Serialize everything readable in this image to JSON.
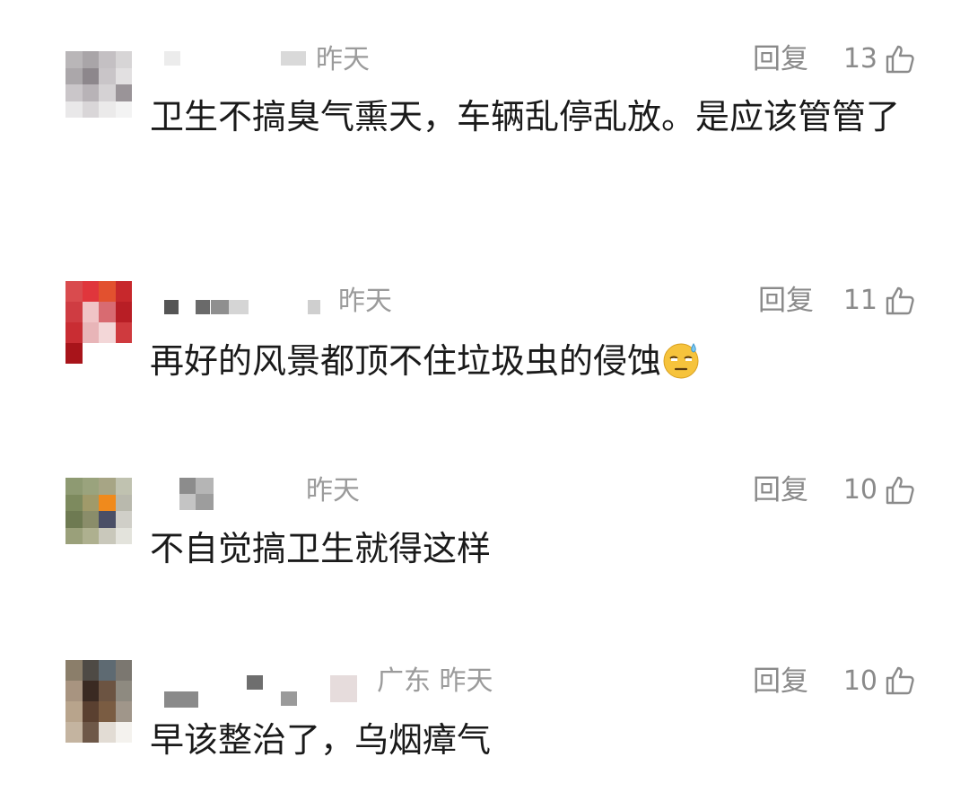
{
  "comments": [
    {
      "location_time": "昨天",
      "reply_label": "回复",
      "likes": "13",
      "text": "卫生不搞臭气熏天，车辆乱停乱放。是应该管管了",
      "thumb_icon": "thumb-up-icon"
    },
    {
      "location_time": "昨天",
      "reply_label": "回复",
      "likes": "11",
      "text": "再好的风景都顶不住垃圾虫的侵蚀",
      "emoji": "sweat-smile-emoji-icon",
      "thumb_icon": "thumb-up-icon"
    },
    {
      "location_time": "昨天",
      "reply_label": "回复",
      "likes": "10",
      "text": "不自觉搞卫生就得这样",
      "thumb_icon": "thumb-up-icon"
    },
    {
      "location_time": "广东 昨天",
      "reply_label": "回复",
      "likes": "10",
      "text": "早该整治了，乌烟瘴气",
      "thumb_icon": "thumb-up-icon"
    }
  ]
}
